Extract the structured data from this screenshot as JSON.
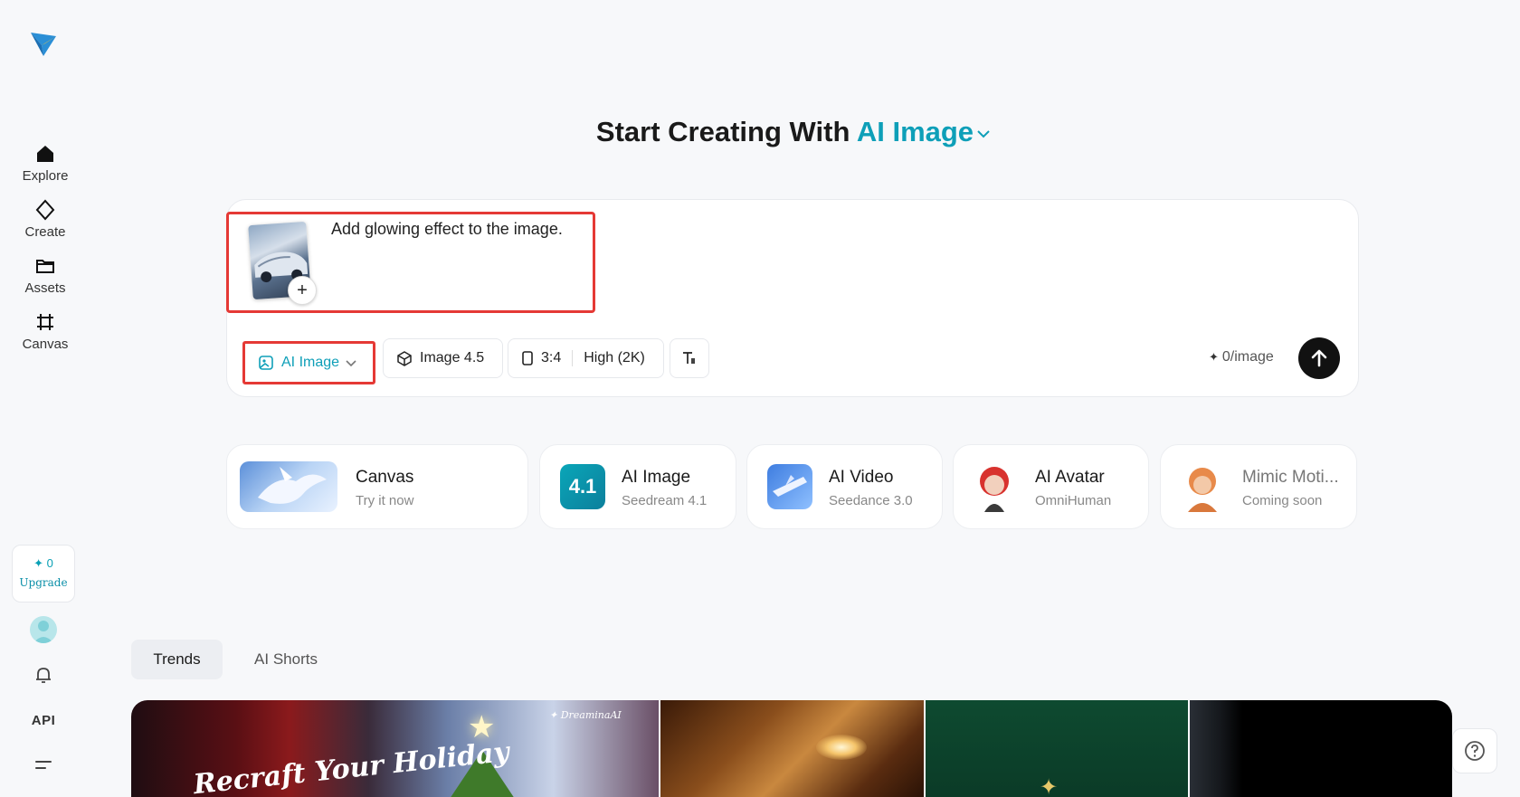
{
  "sidebar": {
    "logo_icon": "dreamina-logo-icon",
    "items": [
      {
        "label": "Explore",
        "icon": "home-icon"
      },
      {
        "label": "Create",
        "icon": "diamond-sparkle-icon"
      },
      {
        "label": "Assets",
        "icon": "folder-icon"
      },
      {
        "label": "Canvas",
        "icon": "crop-canvas-icon"
      }
    ],
    "credits": "0",
    "upgrade_label": "Upgrade",
    "api_label": "API"
  },
  "heading": {
    "prefix": "Start Creating With",
    "accent": "AI Image"
  },
  "prompt": {
    "text": "Add glowing effect to the image.",
    "add_symbol": "+"
  },
  "toolbar": {
    "type_label": "AI Image",
    "model_label": "Image 4.5",
    "ratio_label": "3:4",
    "quality_label": "High (2K)",
    "cost_label": "0/image"
  },
  "tools": [
    {
      "title": "Canvas",
      "subtitle": "Try it now"
    },
    {
      "title": "AI Image",
      "subtitle": "Seedream 4.1",
      "badge": "4.1"
    },
    {
      "title": "AI Video",
      "subtitle": "Seedance 3.0"
    },
    {
      "title": "AI Avatar",
      "subtitle": "OmniHuman"
    },
    {
      "title": "Mimic Moti...",
      "subtitle": "Coming soon"
    }
  ],
  "tabs": [
    {
      "label": "Trends"
    },
    {
      "label": "AI Shorts"
    }
  ],
  "gallery": {
    "tile1_title": "Recraft Your Holiday",
    "tile1_brand": "✦ DreaminaAI"
  },
  "colors": {
    "accent": "#0e9fb8",
    "highlight": "#e53935",
    "send_button": "#111111"
  }
}
